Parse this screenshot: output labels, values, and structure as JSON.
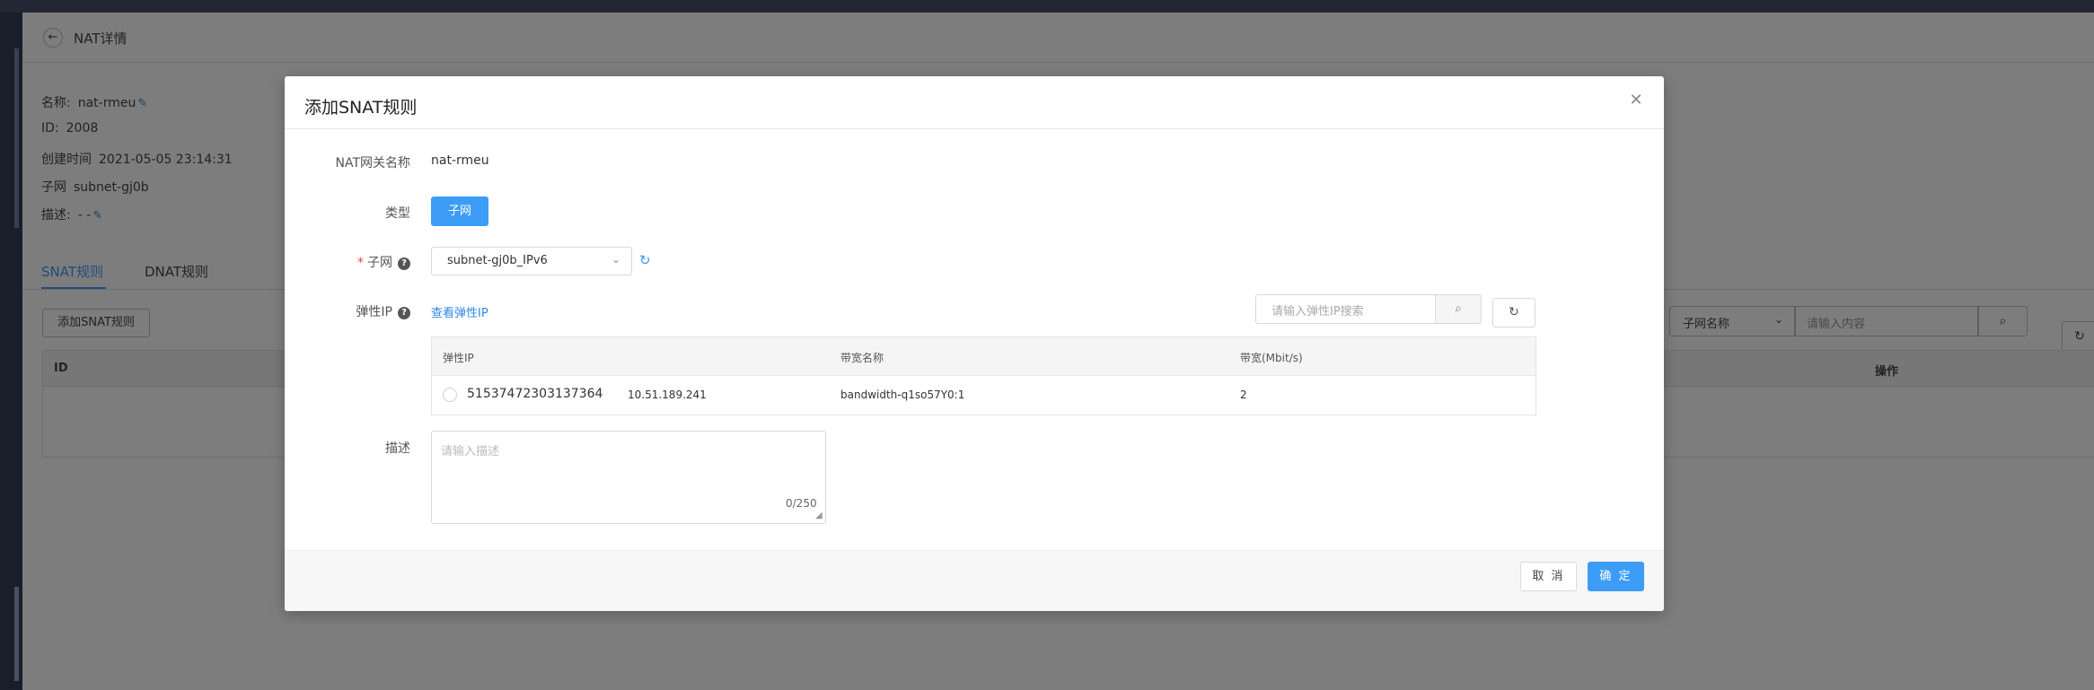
{
  "page": {
    "title": "NAT详情",
    "info": {
      "name_label": "名称:",
      "name_value": "nat-rmeu",
      "id_label": "ID:",
      "id_value": "2008",
      "created_label": "创建时间",
      "created_value": "2021-05-05 23:14:31",
      "subnet_label": "子网",
      "subnet_value": "subnet-gj0b",
      "desc_label": "描述:",
      "desc_value": "- -"
    },
    "tabs": [
      {
        "label": "SNAT规则",
        "active": true
      },
      {
        "label": "DNAT规则",
        "active": false
      }
    ],
    "add_button": "添加SNAT规则",
    "filter": {
      "select_value": "子网名称",
      "input_placeholder": "请输入内容"
    },
    "table_headers": {
      "id": "ID",
      "operation": "操作"
    }
  },
  "modal": {
    "title": "添加SNAT规则",
    "gateway_name_label": "NAT网关名称",
    "gateway_name_value": "nat-rmeu",
    "type_label": "类型",
    "type_button": "子网",
    "subnet_label": "子网",
    "subnet_required_mark": "*",
    "subnet_select_value": "subnet-gj0b_IPv6",
    "eip_label": "弹性IP",
    "view_eip_link": "查看弹性IP",
    "eip_search_placeholder": "请输入弹性IP搜索",
    "eip_table": {
      "headers": {
        "eip": "弹性IP",
        "bandwidth_name": "带宽名称",
        "bandwidth": "带宽(Mbit/s)"
      },
      "rows": [
        {
          "id": "51537472303137364",
          "ip": "10.51.189.241",
          "bandwidth_name": "bandwidth-q1so57Y0:1",
          "bandwidth": "2",
          "selected": false
        }
      ]
    },
    "desc_label": "描述",
    "desc_placeholder": "请输入描述",
    "desc_counter": "0/250",
    "cancel_button": "取 消",
    "ok_button": "确 定"
  },
  "colors": {
    "primary": "#3d9cf5",
    "link": "#2f87e6",
    "required": "#e64545",
    "overlay_bg": "#7d7d7d"
  },
  "icons": {
    "back": "arrow-left-icon",
    "edit": "pencil-icon",
    "close": "close-icon",
    "chevron": "chevron-down-icon",
    "refresh": "refresh-icon",
    "search": "search-icon",
    "help": "question-circle-icon",
    "resize": "resize-grip-icon"
  }
}
